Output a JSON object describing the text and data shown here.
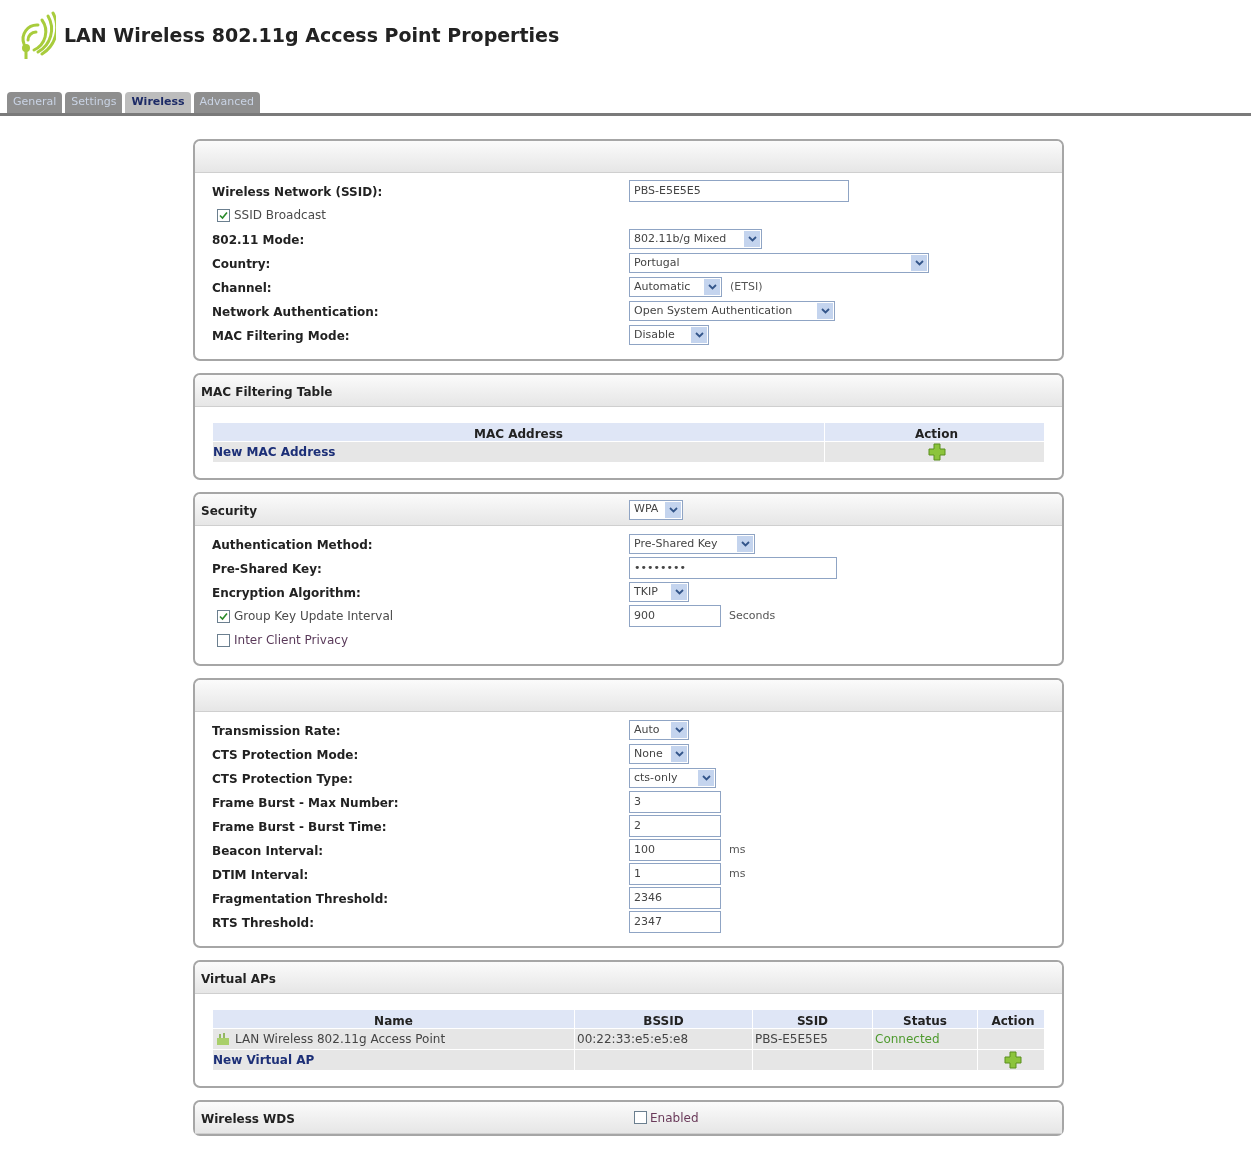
{
  "header": {
    "title": "LAN Wireless 802.11g Access Point Properties"
  },
  "tabs": [
    {
      "label": "General",
      "selected": false
    },
    {
      "label": "Settings",
      "selected": false
    },
    {
      "label": "Wireless",
      "selected": true
    },
    {
      "label": "Advanced",
      "selected": false
    }
  ],
  "panels": [
    {
      "kind": "form",
      "rows": [
        {
          "kind": "wide_input",
          "label": "Wireless Network (SSID):",
          "value": "PBS-E5E5E5"
        },
        {
          "kind": "checkbox",
          "label": "SSID Broadcast",
          "checked": true
        },
        {
          "kind": "select",
          "label": "802.11 Mode:",
          "value": "802.11b/g Mixed"
        },
        {
          "kind": "wide_select",
          "label": "Country:",
          "value": "Portugal"
        },
        {
          "kind": "select",
          "label": "Channel:",
          "value": "Automatic",
          "suffix": "(ETSI)"
        },
        {
          "kind": "select",
          "label": "Network Authentication:",
          "value": "Open System Authentication"
        },
        {
          "kind": "select",
          "label": "MAC Filtering Mode:",
          "value": "Disable"
        }
      ]
    },
    {
      "kind": "table",
      "title": "MAC Filtering Table",
      "columns": [
        {
          "label": "MAC Address",
          "kind": "text"
        },
        {
          "label": "Action",
          "kind": "action"
        }
      ],
      "rows": [
        {
          "kind": "add",
          "label": "New MAC Address"
        }
      ]
    },
    {
      "kind": "form",
      "title": "Security",
      "title_select": "WPA",
      "rows": [
        {
          "kind": "select",
          "label": "Authentication Method:",
          "value": "Pre-Shared Key"
        },
        {
          "kind": "wide_input",
          "label": "Pre-Shared Key:",
          "value": "••••••••"
        },
        {
          "kind": "select",
          "label": "Encryption Algorithm:",
          "value": "TKIP"
        },
        {
          "kind": "checkbox",
          "label": "Group Key Update Interval",
          "checked": true,
          "value": "900",
          "suffix": "Seconds"
        },
        {
          "kind": "checkbox",
          "label": "Inter Client Privacy",
          "checked": false
        }
      ]
    },
    {
      "kind": "form",
      "rows": [
        {
          "kind": "select",
          "label": "Transmission Rate:",
          "value": "Auto"
        },
        {
          "kind": "select",
          "label": "CTS Protection Mode:",
          "value": "None"
        },
        {
          "kind": "select",
          "label": "CTS Protection Type:",
          "value": "cts-only"
        },
        {
          "kind": "input",
          "label": "Frame Burst - Max Number:",
          "value": "3"
        },
        {
          "kind": "input",
          "label": "Frame Burst - Burst Time:",
          "value": "2"
        },
        {
          "kind": "input",
          "label": "Beacon Interval:",
          "value": "100",
          "suffix": "ms"
        },
        {
          "kind": "input",
          "label": "DTIM Interval:",
          "value": "1",
          "suffix": "ms"
        },
        {
          "kind": "input",
          "label": "Fragmentation Threshold:",
          "value": "2346"
        },
        {
          "kind": "input",
          "label": "RTS Threshold:",
          "value": "2347"
        }
      ]
    },
    {
      "kind": "table",
      "title": "Virtual APs",
      "columns": [
        {
          "label": "Name",
          "kind": "name"
        },
        {
          "label": "BSSID",
          "kind": "text"
        },
        {
          "label": "SSID",
          "kind": "text"
        },
        {
          "label": "Status",
          "kind": "status"
        },
        {
          "label": "Action",
          "kind": "action"
        }
      ],
      "rows": [
        {
          "kind": "entry",
          "cells": [
            "LAN Wireless 802.11g Access Point",
            "00:22:33:e5:e5:e8",
            "PBS-E5E5E5",
            "Connected",
            ""
          ]
        },
        {
          "kind": "add",
          "label": "New Virtual AP"
        }
      ]
    },
    {
      "kind": "header_only",
      "title": "Wireless WDS",
      "title_checkbox": {
        "label": "Enabled",
        "checked": false
      }
    }
  ]
}
